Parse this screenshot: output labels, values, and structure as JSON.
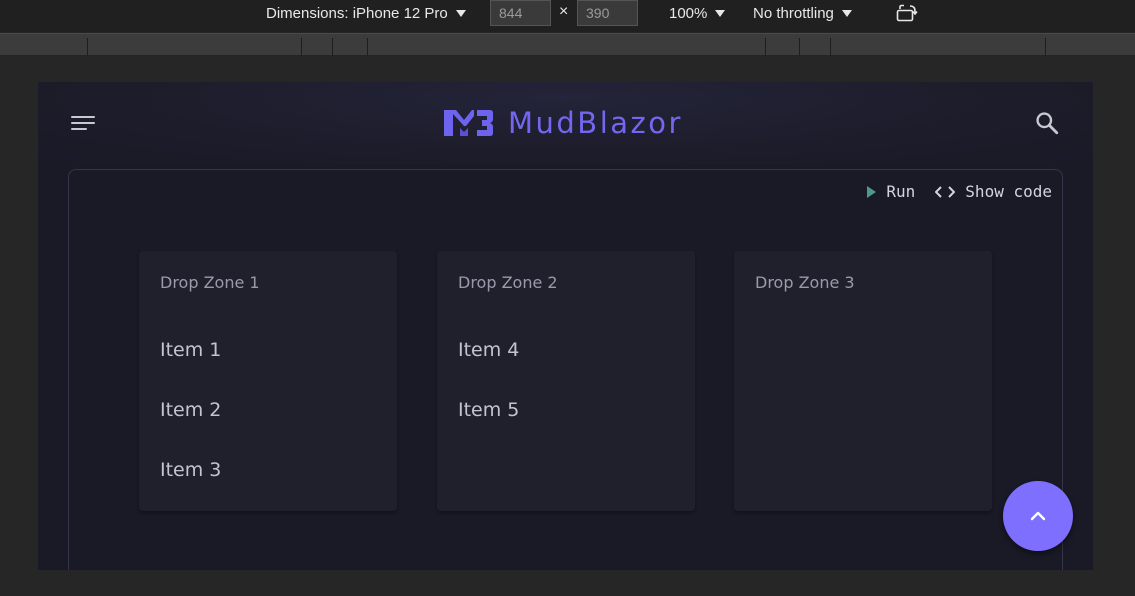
{
  "devtools": {
    "dimensions_label": "Dimensions: iPhone 12 Pro",
    "width_value": "844",
    "height_value": "390",
    "times": "×",
    "zoom": "100%",
    "throttling": "No throttling"
  },
  "app": {
    "brand": "MudBlazor",
    "brand_color": "#7467ef",
    "icons": [
      "menu-icon",
      "search-icon",
      "mudblazor-logo"
    ]
  },
  "example": {
    "run_label": "Run",
    "show_code_label": "Show code",
    "zones": [
      {
        "title": "Drop Zone 1",
        "items": [
          "Item 1",
          "Item 2",
          "Item 3"
        ]
      },
      {
        "title": "Drop Zone 2",
        "items": [
          "Item 4",
          "Item 5"
        ]
      },
      {
        "title": "Drop Zone 3",
        "items": []
      }
    ]
  },
  "fab": {
    "icon": "chevron-up-icon",
    "color": "#7e6fff"
  }
}
